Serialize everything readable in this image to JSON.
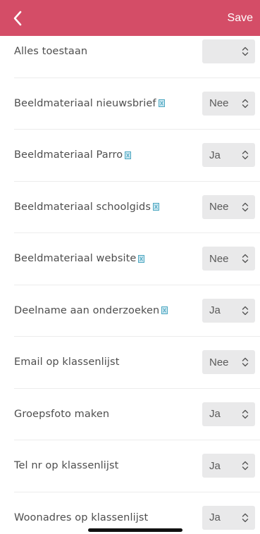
{
  "navbar": {
    "save_label": "Save",
    "color": "#d44d67",
    "back_icon": "chevron-left-icon"
  },
  "settings": [
    {
      "label": "Alles toestaan",
      "value": "",
      "info": false
    },
    {
      "label": "Beeldmateriaal nieuwsbrief",
      "value": "Nee",
      "info": true
    },
    {
      "label": "Beeldmateriaal Parro",
      "value": "Ja",
      "info": true
    },
    {
      "label": "Beeldmateriaal schoolgids",
      "value": "Nee",
      "info": true
    },
    {
      "label": "Beeldmateriaal website",
      "value": "Nee",
      "info": true
    },
    {
      "label": "Deelname aan onderzoeken",
      "value": "Ja",
      "info": true
    },
    {
      "label": "Email op klassenlijst",
      "value": "Nee",
      "info": false
    },
    {
      "label": "Groepsfoto maken",
      "value": "Ja",
      "info": false
    },
    {
      "label": "Tel nr op klassenlijst",
      "value": "Ja",
      "info": false
    },
    {
      "label": "Woonadres op klassenlijst",
      "value": "Ja",
      "info": false
    }
  ]
}
